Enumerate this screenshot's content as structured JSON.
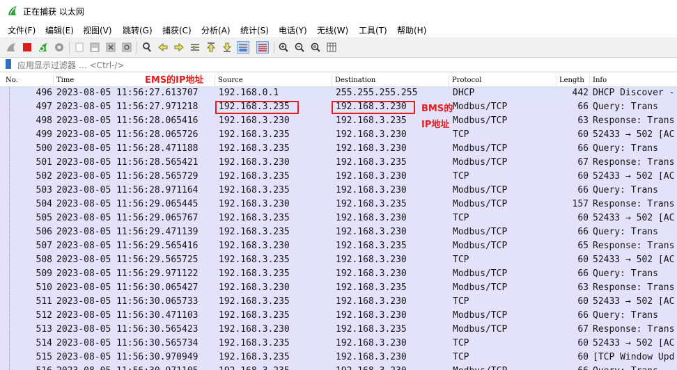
{
  "window": {
    "title": "正在捕获 以太网"
  },
  "menu": [
    "文件(F)",
    "编辑(E)",
    "视图(V)",
    "跳转(G)",
    "捕获(C)",
    "分析(A)",
    "统计(S)",
    "电话(Y)",
    "无线(W)",
    "工具(T)",
    "帮助(H)"
  ],
  "filter": {
    "placeholder": "应用显示过滤器 … <Ctrl-/>"
  },
  "columns": [
    "No.",
    "Time",
    "Source",
    "Destination",
    "Protocol",
    "Length",
    "Info"
  ],
  "annotations": {
    "ems": "EMS的IP地址",
    "bms_line1": "BMS的",
    "bms_line2": "IP地址"
  },
  "packets": [
    {
      "no": "496",
      "time": "2023-08-05 11:56:27.613707",
      "src": "192.168.0.1",
      "dst": "255.255.255.255",
      "proto": "DHCP",
      "len": "442",
      "info": "DHCP Discover -"
    },
    {
      "no": "497",
      "time": "2023-08-05 11:56:27.971218",
      "src": "192.168.3.235",
      "dst": "192.168.3.230",
      "proto": "Modbus/TCP",
      "len": "66",
      "info": "   Query: Trans"
    },
    {
      "no": "498",
      "time": "2023-08-05 11:56:28.065416",
      "src": "192.168.3.230",
      "dst": "192.168.3.235",
      "proto": "Modbus/TCP",
      "len": "63",
      "info": "Response: Trans"
    },
    {
      "no": "499",
      "time": "2023-08-05 11:56:28.065726",
      "src": "192.168.3.235",
      "dst": "192.168.3.230",
      "proto": "TCP",
      "len": "60",
      "info": "52433 → 502 [AC"
    },
    {
      "no": "500",
      "time": "2023-08-05 11:56:28.471188",
      "src": "192.168.3.235",
      "dst": "192.168.3.230",
      "proto": "Modbus/TCP",
      "len": "66",
      "info": "   Query: Trans"
    },
    {
      "no": "501",
      "time": "2023-08-05 11:56:28.565421",
      "src": "192.168.3.230",
      "dst": "192.168.3.235",
      "proto": "Modbus/TCP",
      "len": "67",
      "info": "Response: Trans"
    },
    {
      "no": "502",
      "time": "2023-08-05 11:56:28.565729",
      "src": "192.168.3.235",
      "dst": "192.168.3.230",
      "proto": "TCP",
      "len": "60",
      "info": "52433 → 502 [AC"
    },
    {
      "no": "503",
      "time": "2023-08-05 11:56:28.971164",
      "src": "192.168.3.235",
      "dst": "192.168.3.230",
      "proto": "Modbus/TCP",
      "len": "66",
      "info": "   Query: Trans"
    },
    {
      "no": "504",
      "time": "2023-08-05 11:56:29.065445",
      "src": "192.168.3.230",
      "dst": "192.168.3.235",
      "proto": "Modbus/TCP",
      "len": "157",
      "info": "Response: Trans"
    },
    {
      "no": "505",
      "time": "2023-08-05 11:56:29.065767",
      "src": "192.168.3.235",
      "dst": "192.168.3.230",
      "proto": "TCP",
      "len": "60",
      "info": "52433 → 502 [AC"
    },
    {
      "no": "506",
      "time": "2023-08-05 11:56:29.471139",
      "src": "192.168.3.235",
      "dst": "192.168.3.230",
      "proto": "Modbus/TCP",
      "len": "66",
      "info": "   Query: Trans"
    },
    {
      "no": "507",
      "time": "2023-08-05 11:56:29.565416",
      "src": "192.168.3.230",
      "dst": "192.168.3.235",
      "proto": "Modbus/TCP",
      "len": "65",
      "info": "Response: Trans"
    },
    {
      "no": "508",
      "time": "2023-08-05 11:56:29.565725",
      "src": "192.168.3.235",
      "dst": "192.168.3.230",
      "proto": "TCP",
      "len": "60",
      "info": "52433 → 502 [AC"
    },
    {
      "no": "509",
      "time": "2023-08-05 11:56:29.971122",
      "src": "192.168.3.235",
      "dst": "192.168.3.230",
      "proto": "Modbus/TCP",
      "len": "66",
      "info": "   Query: Trans"
    },
    {
      "no": "510",
      "time": "2023-08-05 11:56:30.065427",
      "src": "192.168.3.230",
      "dst": "192.168.3.235",
      "proto": "Modbus/TCP",
      "len": "63",
      "info": "Response: Trans"
    },
    {
      "no": "511",
      "time": "2023-08-05 11:56:30.065733",
      "src": "192.168.3.235",
      "dst": "192.168.3.230",
      "proto": "TCP",
      "len": "60",
      "info": "52433 → 502 [AC"
    },
    {
      "no": "512",
      "time": "2023-08-05 11:56:30.471103",
      "src": "192.168.3.235",
      "dst": "192.168.3.230",
      "proto": "Modbus/TCP",
      "len": "66",
      "info": "   Query: Trans"
    },
    {
      "no": "513",
      "time": "2023-08-05 11:56:30.565423",
      "src": "192.168.3.230",
      "dst": "192.168.3.235",
      "proto": "Modbus/TCP",
      "len": "67",
      "info": "Response: Trans"
    },
    {
      "no": "514",
      "time": "2023-08-05 11:56:30.565734",
      "src": "192.168.3.235",
      "dst": "192.168.3.230",
      "proto": "TCP",
      "len": "60",
      "info": "52433 → 502 [AC"
    },
    {
      "no": "515",
      "time": "2023-08-05 11:56:30.970949",
      "src": "192.168.3.235",
      "dst": "192.168.3.230",
      "proto": "TCP",
      "len": "60",
      "info": "[TCP Window Upd"
    },
    {
      "no": "516",
      "time": "2023-08-05 11:56:30.971105",
      "src": "192.168.3.235",
      "dst": "192.168.3.230",
      "proto": "Modbus/TCP",
      "len": "66",
      "info": "   Query: Trans"
    }
  ],
  "colors": {
    "row_bg": "#e4e2fa",
    "annotation": "#e02020"
  },
  "toolbar_icons": [
    "shark-fin-start-icon",
    "stop-square-icon",
    "restart-shark-icon",
    "capture-options-gear-icon",
    "open-file-icon",
    "save-file-icon",
    "close-file-icon",
    "reload-icon",
    "find-packet-icon",
    "go-back-arrow-icon",
    "go-forward-arrow-icon",
    "go-to-packet-icon",
    "go-first-packet-icon",
    "go-last-packet-icon",
    "autoscroll-icon",
    "colorize-icon",
    "zoom-in-icon",
    "zoom-out-icon",
    "zoom-normal-icon",
    "resize-columns-icon"
  ]
}
